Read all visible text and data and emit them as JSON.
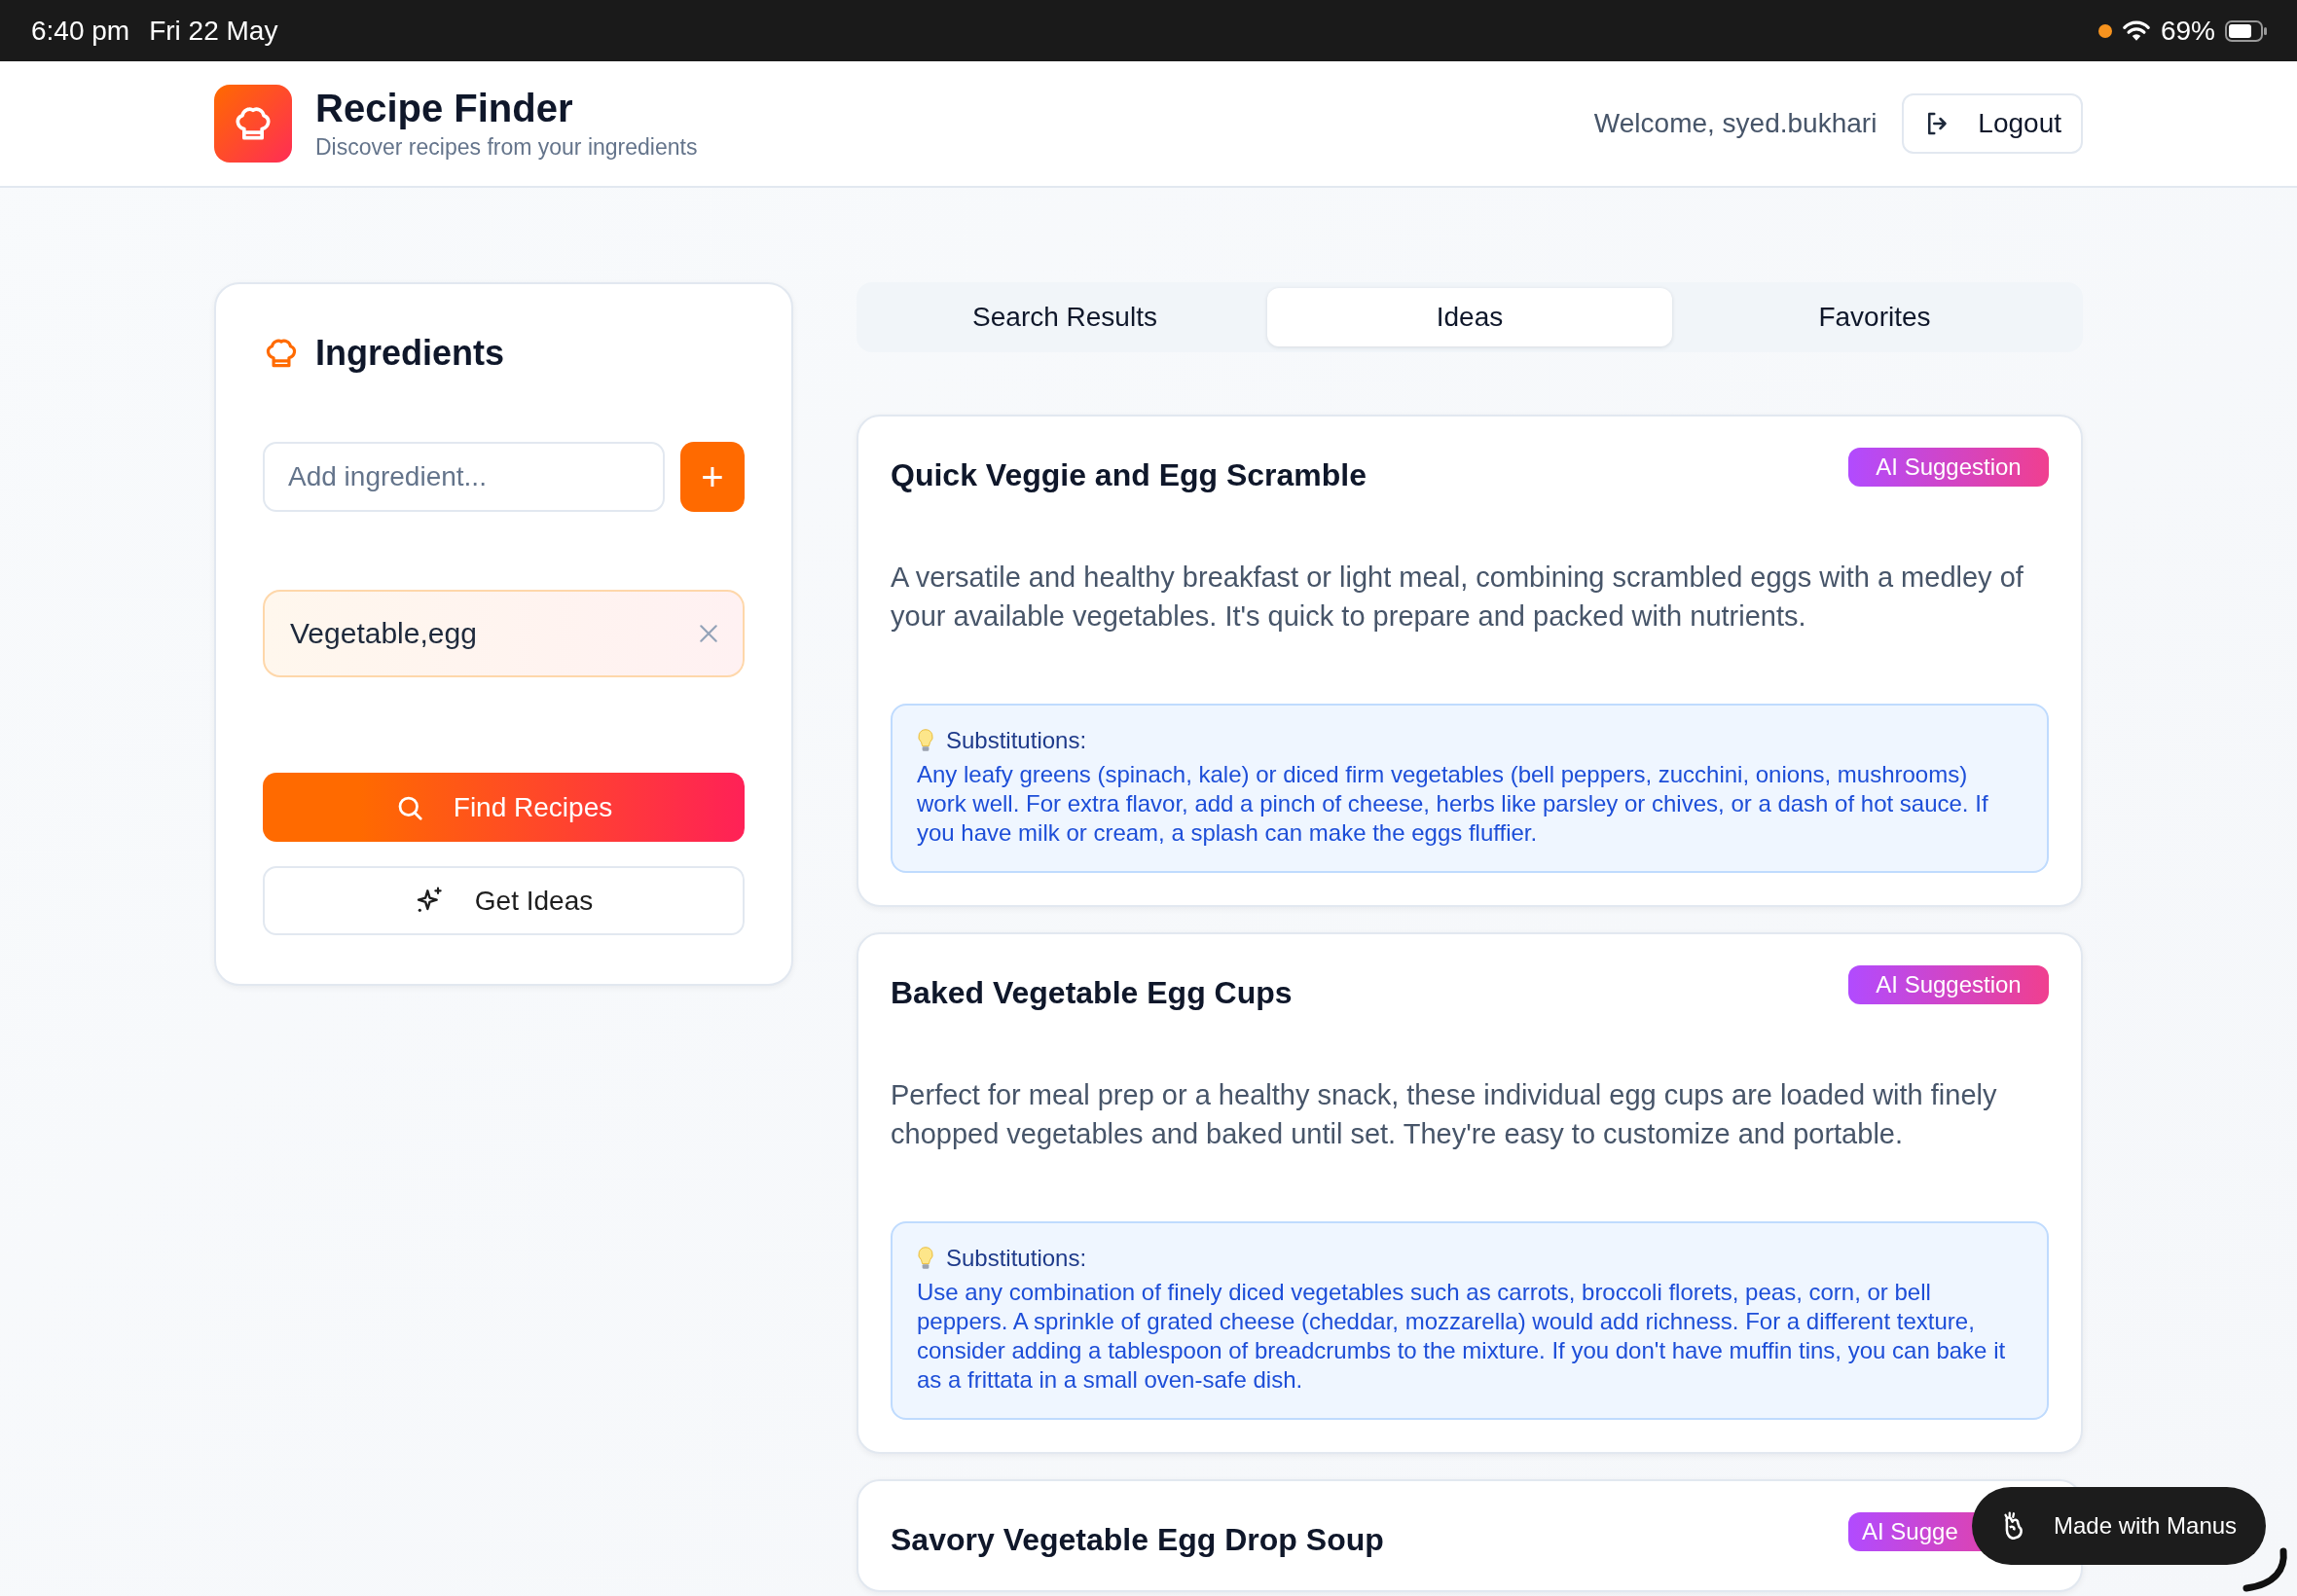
{
  "status_bar": {
    "time": "6:40 pm",
    "date": "Fri 22 May",
    "battery": "69%"
  },
  "header": {
    "title": "Recipe Finder",
    "subtitle": "Discover recipes from your ingredients",
    "welcome": "Welcome, syed.bukhari",
    "logout": "Logout"
  },
  "ingredients_panel": {
    "title": "Ingredients",
    "input": {
      "placeholder": "Add ingredient..."
    },
    "add_button": "+",
    "chips": [
      {
        "label": "Vegetable,egg"
      }
    ],
    "buttons": [
      {
        "kind": "primary",
        "label": "Find Recipes"
      },
      {
        "kind": "secondary",
        "label": "Get Ideas"
      }
    ]
  },
  "tabs": [
    {
      "label": "Search Results",
      "selected": false
    },
    {
      "label": "Ideas",
      "selected": true
    },
    {
      "label": "Favorites",
      "selected": false
    }
  ],
  "ideas": [
    {
      "title": "Quick Veggie and Egg Scramble",
      "badge": "AI Suggestion",
      "description": "A versatile and healthy breakfast or light meal, combining scrambled eggs with a medley of your available vegetables. It's quick to prepare and packed with nutrients.",
      "substitutions_title": "Substitutions:",
      "substitutions": "Any leafy greens (spinach, kale) or diced firm vegetables (bell peppers, zucchini, onions, mushrooms) work well. For extra flavor, add a pinch of cheese, herbs like parsley or chives, or a dash of hot sauce. If you have milk or cream, a splash can make the eggs fluffier."
    },
    {
      "title": "Baked Vegetable Egg Cups",
      "badge": "AI Suggestion",
      "description": "Perfect for meal prep or a healthy snack, these individual egg cups are loaded with finely chopped vegetables and baked until set. They're easy to customize and portable.",
      "substitutions_title": "Substitutions:",
      "substitutions": "Use any combination of finely diced vegetables such as carrots, broccoli florets, peas, corn, or bell peppers. A sprinkle of grated cheese (cheddar, mozzarella) would add richness. For a different texture, consider adding a tablespoon of breadcrumbs to the mixture. If you don't have muffin tins, you can bake it as a frittata in a small oven-safe dish."
    },
    {
      "title": "Savory Vegetable Egg Drop Soup",
      "badge": "AI Sugge"
    }
  ],
  "made_with": {
    "label": "Made with Manus"
  }
}
